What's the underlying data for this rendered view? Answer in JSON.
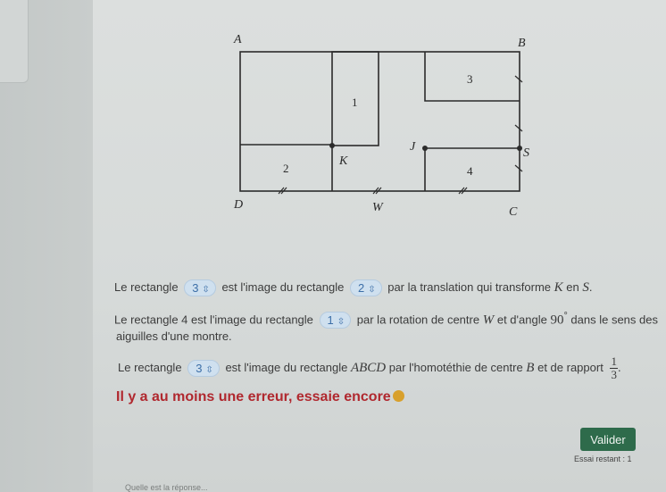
{
  "figure": {
    "labels": {
      "A": "A",
      "B": "B",
      "C": "C",
      "D": "D",
      "K": "K",
      "J": "J",
      "S": "S",
      "W": "W",
      "r1": "1",
      "r2": "2",
      "r3": "3",
      "r4": "4"
    }
  },
  "questions": [
    {
      "pre": "Le rectangle",
      "answer": "3",
      "mid": "est l'image du rectangle",
      "answer2": "2",
      "post": "par la translation qui transforme",
      "k": "K",
      "en": "en",
      "s": "S",
      "end": "."
    },
    {
      "pre": "Le rectangle 4 est l'image du rectangle",
      "answer": "1",
      "post": "par la rotation de centre",
      "w": "W",
      "mid": "et d'angle",
      "angle": "90",
      "deg": "°",
      "post2": "dans le sens des",
      "line2": "aiguilles d'une montre."
    },
    {
      "pre": "Le rectangle",
      "answer": "3",
      "post": "est l'image du rectangle",
      "abcd": "ABCD",
      "mid": "par l'homotéthie de centre",
      "b": "B",
      "mid2": "et de rapport",
      "num": "1",
      "den": "3",
      "end": "."
    }
  ],
  "feedback": "Il y a au moins une erreur, essaie encore",
  "validate_label": "Valider",
  "tries_label": "Essai restant : 1",
  "bottom_hint": "Quelle est la réponse..."
}
